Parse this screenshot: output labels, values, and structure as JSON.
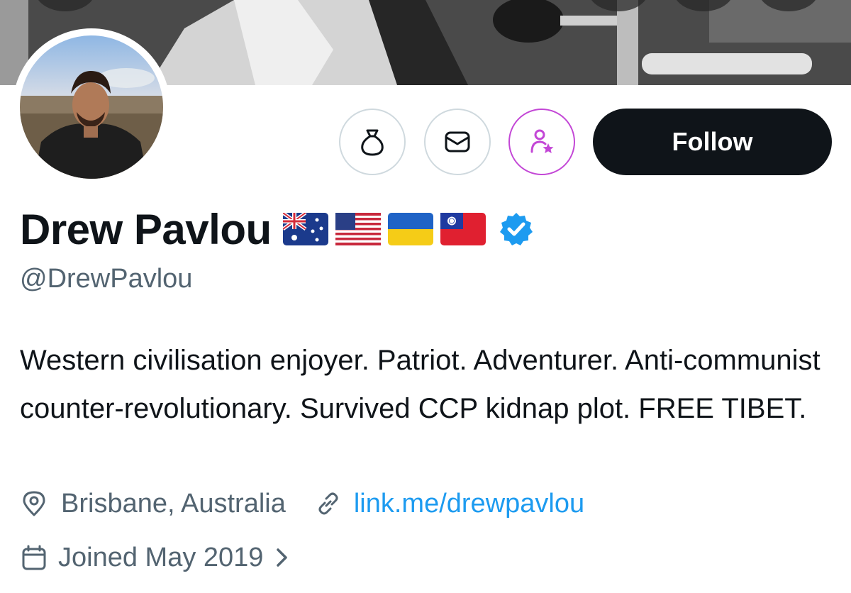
{
  "profile": {
    "display_name": "Drew Pavlou",
    "handle": "@DrewPavlou",
    "bio": "Western civilisation enjoyer. Patriot. Adventurer. Anti-communist counter-revolutionary. Survived CCP kidnap plot. FREE TIBET.",
    "flags": [
      "flag-australia-icon",
      "flag-usa-icon",
      "flag-ukraine-icon",
      "flag-taiwan-icon"
    ],
    "verified_badge": "verified-badge-icon",
    "location": "Brisbane, Australia",
    "website": "link.me/drewpavlou",
    "joined": "Joined May 2019"
  },
  "actions": {
    "tip_icon": "money-bag-icon",
    "message_icon": "envelope-icon",
    "subscribe_icon": "person-star-icon",
    "follow_label": "Follow"
  },
  "icons": {
    "location": "map-pin-icon",
    "website": "link-icon",
    "joined": "calendar-icon",
    "joined_chevron": "chevron-right-icon"
  },
  "colors": {
    "text": "#0f1419",
    "secondary": "#536471",
    "link": "#1d9bf0",
    "verified": "#1d9bf0",
    "subscribe_accent": "#c347d6",
    "follow_bg": "#0f1419"
  }
}
